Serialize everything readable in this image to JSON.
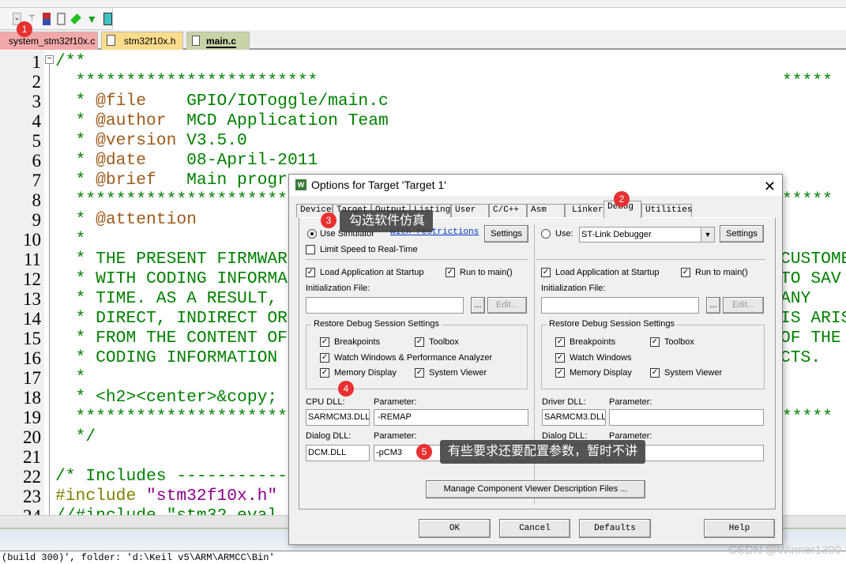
{
  "toolbar": {
    "icons": [
      "dropdown-icon",
      "wand-icon",
      "component-icon",
      "copy-icon",
      "diamond-icon",
      "funnel-icon",
      "pack-icon"
    ]
  },
  "file_tabs": [
    {
      "label": "system_stm32f10x.c",
      "color": "#f2a8a8"
    },
    {
      "label": "stm32f10x.h",
      "color": "#fadc8c"
    },
    {
      "label": "main.c",
      "color": "#c8d4a8",
      "active": true
    }
  ],
  "editor": {
    "line_numbers": [
      "1",
      "2",
      "3",
      "4",
      "5",
      "6",
      "7",
      "8",
      "9",
      "10",
      "11",
      "12",
      "13",
      "14",
      "15",
      "16",
      "17",
      "18",
      "19",
      "20",
      "21",
      "22",
      "23",
      "24"
    ],
    "lines": [
      "/**",
      "  ************************",
      "  * @file    GPIO/IOToggle/main.c",
      "  * @author  MCD Application Team",
      "  * @version V3.5.0",
      "  * @date    08-April-2011",
      "  * @brief   Main progr",
      "  ************************",
      "  * @attention",
      "  *",
      "  * THE PRESENT FIRMWAR",
      "  * WITH CODING INFORMA",
      "  * TIME. AS A RESULT,",
      "  * DIRECT, INDIRECT OR",
      "  * FROM THE CONTENT OF",
      "  * CODING INFORMATION",
      "  *",
      "  * <h2><center>&copy;",
      "  ************************",
      "  */",
      "",
      "/* Includes -----------",
      "#include \"stm32f10x.h\"",
      "//#include \"stm32_eval"
    ],
    "right_fragments": {
      "2": "*****",
      "8": "*****",
      "11": "CUSTOME",
      "12": "TO SAV",
      "13": "ANY",
      "14": "IS ARIS",
      "15": "OF THE",
      "16": "CTS.",
      "19": "*****"
    }
  },
  "status": {
    "text": "(build 300)', folder: 'd:\\Keil v5\\ARM\\ARMCC\\Bin'"
  },
  "watermark": "CSDN @Winner1300",
  "dialog": {
    "title": "Options for Target 'Target 1'",
    "tabs": [
      "Device",
      "Target",
      "Output",
      "Listing",
      "User",
      "C/C++",
      "Asm",
      "Linker",
      "Debug",
      "Utilities"
    ],
    "active_tab": "Debug",
    "left": {
      "use_simulator": "Use Simulator",
      "with_restrictions": "with restrictions",
      "settings": "Settings",
      "limit_speed": "Limit Speed to Real-Time",
      "load_app": "Load Application at Startup",
      "run_to_main": "Run to main()",
      "init_file": "Initialization File:",
      "init_value": "",
      "browse": "...",
      "edit": "Edit...",
      "restore": "Restore Debug Session Settings",
      "breakpoints": "Breakpoints",
      "toolbox": "Toolbox",
      "watch": "Watch Windows & Performance Analyzer",
      "memory": "Memory Display",
      "sysviewer": "System Viewer",
      "cpu_dll": "CPU DLL:",
      "cpu_dll_value": "SARMCM3.DLL",
      "param": "Parameter:",
      "cpu_param": "-REMAP",
      "dialog_dll": "Dialog DLL:",
      "dialog_dll_value": "DCM.DLL",
      "dialog_param": "-pCM3"
    },
    "right": {
      "use": "Use:",
      "debugger": "ST-Link Debugger",
      "settings": "Settings",
      "load_app": "Load Application at Startup",
      "run_to_main": "Run to main()",
      "init_file": "Initialization File:",
      "browse": "...",
      "edit": "Edit...",
      "restore": "Restore Debug Session Settings",
      "breakpoints": "Breakpoints",
      "toolbox": "Toolbox",
      "watch": "Watch Windows",
      "memory": "Memory Display",
      "sysviewer": "System Viewer",
      "driver_dll": "Driver DLL:",
      "driver_dll_value": "SARMCM3.DLL",
      "param": "Parameter:",
      "driver_param": "",
      "dialog_dll": "Dialog DLL:",
      "dialog_param_label": "Parameter:"
    },
    "manage": "Manage Component Viewer Description Files ...",
    "ok": "OK",
    "cancel": "Cancel",
    "defaults": "Defaults",
    "help": "Help"
  },
  "annotations": {
    "b1": "1",
    "b2": "2",
    "b3": "3",
    "b4": "4",
    "b5": "5",
    "tip3": "勾选软件仿真",
    "tip5": "有些要求还要配置参数，暂时不讲"
  }
}
